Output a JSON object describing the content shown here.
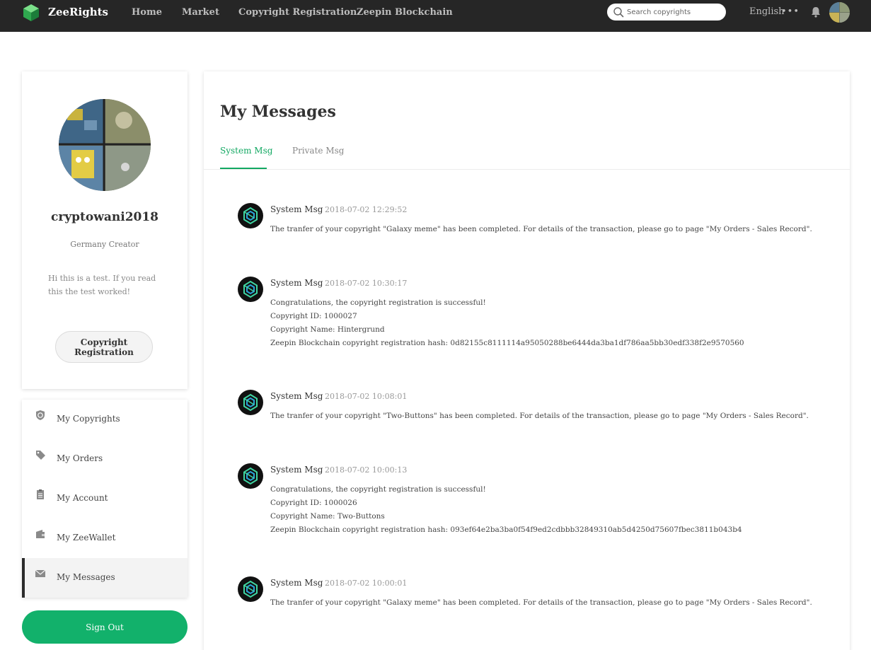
{
  "app": {
    "brand": "ZeeRights",
    "nav": [
      "Home",
      "Market",
      "Copyright Registration",
      "Zeepin Blockchain"
    ],
    "search_placeholder": "Search copyrights",
    "language": "English",
    "more": "•••"
  },
  "profile": {
    "username": "cryptowani2018",
    "location": "Germany Creator",
    "bio": "Hi this is a test. If you read this the test worked!",
    "register_button": "Copyright Registration"
  },
  "menu": {
    "items": [
      {
        "label": "My Copyrights",
        "icon": "copyright-icon"
      },
      {
        "label": "My Orders",
        "icon": "tag-icon"
      },
      {
        "label": "My Account",
        "icon": "clipboard-icon"
      },
      {
        "label": "My ZeeWallet",
        "icon": "wallet-icon"
      },
      {
        "label": "My Messages",
        "icon": "mail-icon"
      }
    ],
    "active_index": 4,
    "signout": "Sign Out"
  },
  "main": {
    "title": "My Messages",
    "tabs": [
      "System Msg",
      "Private Msg"
    ],
    "active_tab": 0,
    "messages": [
      {
        "sender": "System Msg",
        "time": "2018-07-02 12:29:52",
        "lines": [
          "The tranfer of your copyright \"Galaxy meme\" has been completed. For details of the transaction, please go to page \"My Orders - Sales Record\"."
        ]
      },
      {
        "sender": "System Msg",
        "time": "2018-07-02 10:30:17",
        "lines": [
          "Congratulations, the copyright registration is successful!",
          "Copyright ID: 1000027",
          "Copyright Name: Hintergrund",
          "Zeepin Blockchain copyright registration hash: 0d82155c8111114a95050288be6444da3ba1df786aa5bb30edf338f2e9570560"
        ]
      },
      {
        "sender": "System Msg",
        "time": "2018-07-02 10:08:01",
        "lines": [
          "The tranfer of your copyright \"Two-Buttons\" has been completed. For details of the transaction, please go to page \"My Orders - Sales Record\"."
        ]
      },
      {
        "sender": "System Msg",
        "time": "2018-07-02 10:00:13",
        "lines": [
          "Congratulations, the copyright registration is successful!",
          "Copyright ID: 1000026",
          "Copyright Name: Two-Buttons",
          "Zeepin Blockchain copyright registration hash: 093ef64e2ba3ba0f54f9ed2cdbbb32849310ab5d4250d75607fbec3811b043b4"
        ]
      },
      {
        "sender": "System Msg",
        "time": "2018-07-02 10:00:01",
        "lines": [
          "The tranfer of your copyright \"Galaxy meme\" has been completed. For details of the transaction, please go to page \"My Orders - Sales Record\"."
        ]
      }
    ]
  },
  "colors": {
    "accent": "#12b16b",
    "topbar": "#262626"
  }
}
